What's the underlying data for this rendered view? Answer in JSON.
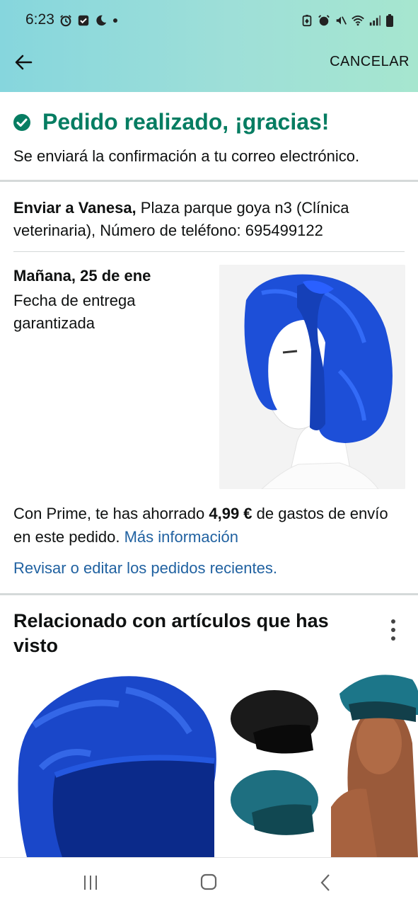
{
  "status_bar": {
    "time": "6:23"
  },
  "header": {
    "cancel_label": "CANCELAR"
  },
  "order": {
    "success_title": "Pedido realizado, ¡gracias!",
    "confirmation_text": "Se enviará la confirmación a tu correo electrónico."
  },
  "shipping": {
    "recipient_label": "Enviar a Vanesa,",
    "address": " Plaza parque goya n3 (Clínica veterinaria), Número de teléfono: 695499122"
  },
  "delivery": {
    "date": "Mañana, 25 de ene",
    "guarantee": "Fecha de entrega garantizada"
  },
  "prime": {
    "text_before": "Con Prime, te has ahorrado ",
    "amount": "4,99 €",
    "text_after": " de gastos de envío en este pedido. ",
    "more_info_link": "Más información"
  },
  "review_link": "Revisar o editar los pedidos recientes.",
  "related": {
    "title": "Relacionado con artículos que has visto"
  },
  "colors": {
    "success": "#067d62",
    "link": "#2162a1",
    "header_start": "#86d6dd",
    "header_end": "#a6e6cf"
  },
  "icons": [
    "alarm-icon",
    "checkbox-icon",
    "moon-icon",
    "dot-icon",
    "battery-saver-icon",
    "mute-icon",
    "wifi-icon",
    "signal-icon",
    "battery-icon",
    "back-arrow-icon",
    "check-circle-icon",
    "more-vertical-icon",
    "recents-icon",
    "home-icon",
    "back-icon"
  ]
}
